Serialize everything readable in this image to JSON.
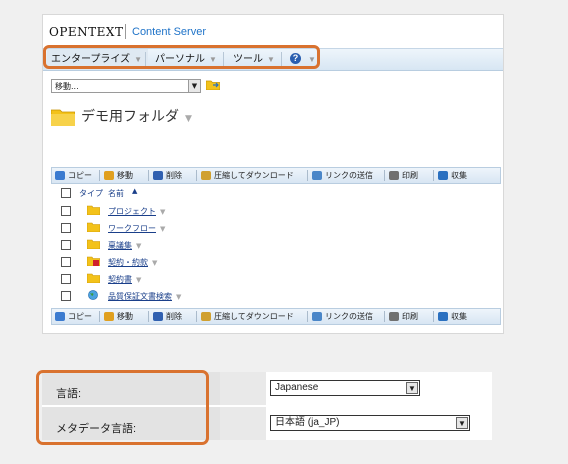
{
  "header": {
    "brand": "OPENTEXT",
    "product": "Content Server"
  },
  "menu": {
    "items": [
      {
        "label": "エンタープライズ"
      },
      {
        "label": "パーソナル"
      },
      {
        "label": "ツール"
      },
      {
        "label": "?"
      }
    ]
  },
  "goto": {
    "value": "移動..."
  },
  "folder": {
    "title": "デモ用フォルダ"
  },
  "toolbar": {
    "items": [
      {
        "label": "コピー",
        "color": "#3b7bd0"
      },
      {
        "label": "移動",
        "color": "#e0a020"
      },
      {
        "label": "削除",
        "color": "#3060b0"
      },
      {
        "label": "圧縮してダウンロード",
        "color": "#d0a030"
      },
      {
        "label": "リンクの送信",
        "color": "#4a86c8"
      },
      {
        "label": "印刷",
        "color": "#707070"
      },
      {
        "label": "収集",
        "color": "#2a70c0"
      }
    ]
  },
  "columns": {
    "type": "タイプ",
    "name": "名前"
  },
  "rows": [
    {
      "name": "プロジェクト",
      "icon": "folder-icon"
    },
    {
      "name": "ワークフロー",
      "icon": "folder-icon"
    },
    {
      "name": "稟議集",
      "icon": "folder-icon"
    },
    {
      "name": "契約・約款",
      "icon": "locked-folder-icon"
    },
    {
      "name": "契約書",
      "icon": "folder-icon"
    },
    {
      "name": "品質保証文書検索",
      "icon": "globe-icon"
    }
  ],
  "settings": {
    "language": {
      "label": "言語:",
      "value": "Japanese"
    },
    "metadata_language": {
      "label": "メタデータ言語:",
      "value": "日本語 (ja_JP)"
    }
  },
  "colors": {
    "highlight": "#d9722f",
    "accent": "#1f73c8"
  }
}
